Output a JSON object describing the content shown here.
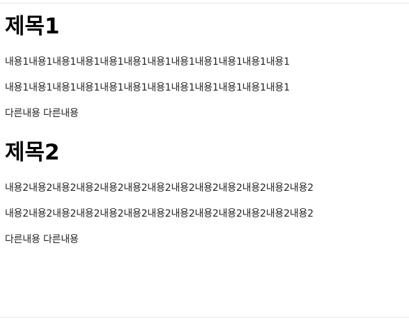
{
  "sections": [
    {
      "title": "제목1",
      "paragraphs": [
        "내용1내용1내용1내용1내용1내용1내용1내용1내용1내용1내용1내용1",
        "내용1내용1내용1내용1내용1내용1내용1내용1내용1내용1내용1내용1",
        "다른내용 다른내용"
      ]
    },
    {
      "title": "제목2",
      "paragraphs": [
        "내용2내용2내용2내용2내용2내용2내용2내용2내용2내용2내용2내용2내용2",
        "내용2내용2내용2내용2내용2내용2내용2내용2내용2내용2내용2내용2내용2",
        "다른내용 다른내용"
      ]
    }
  ]
}
